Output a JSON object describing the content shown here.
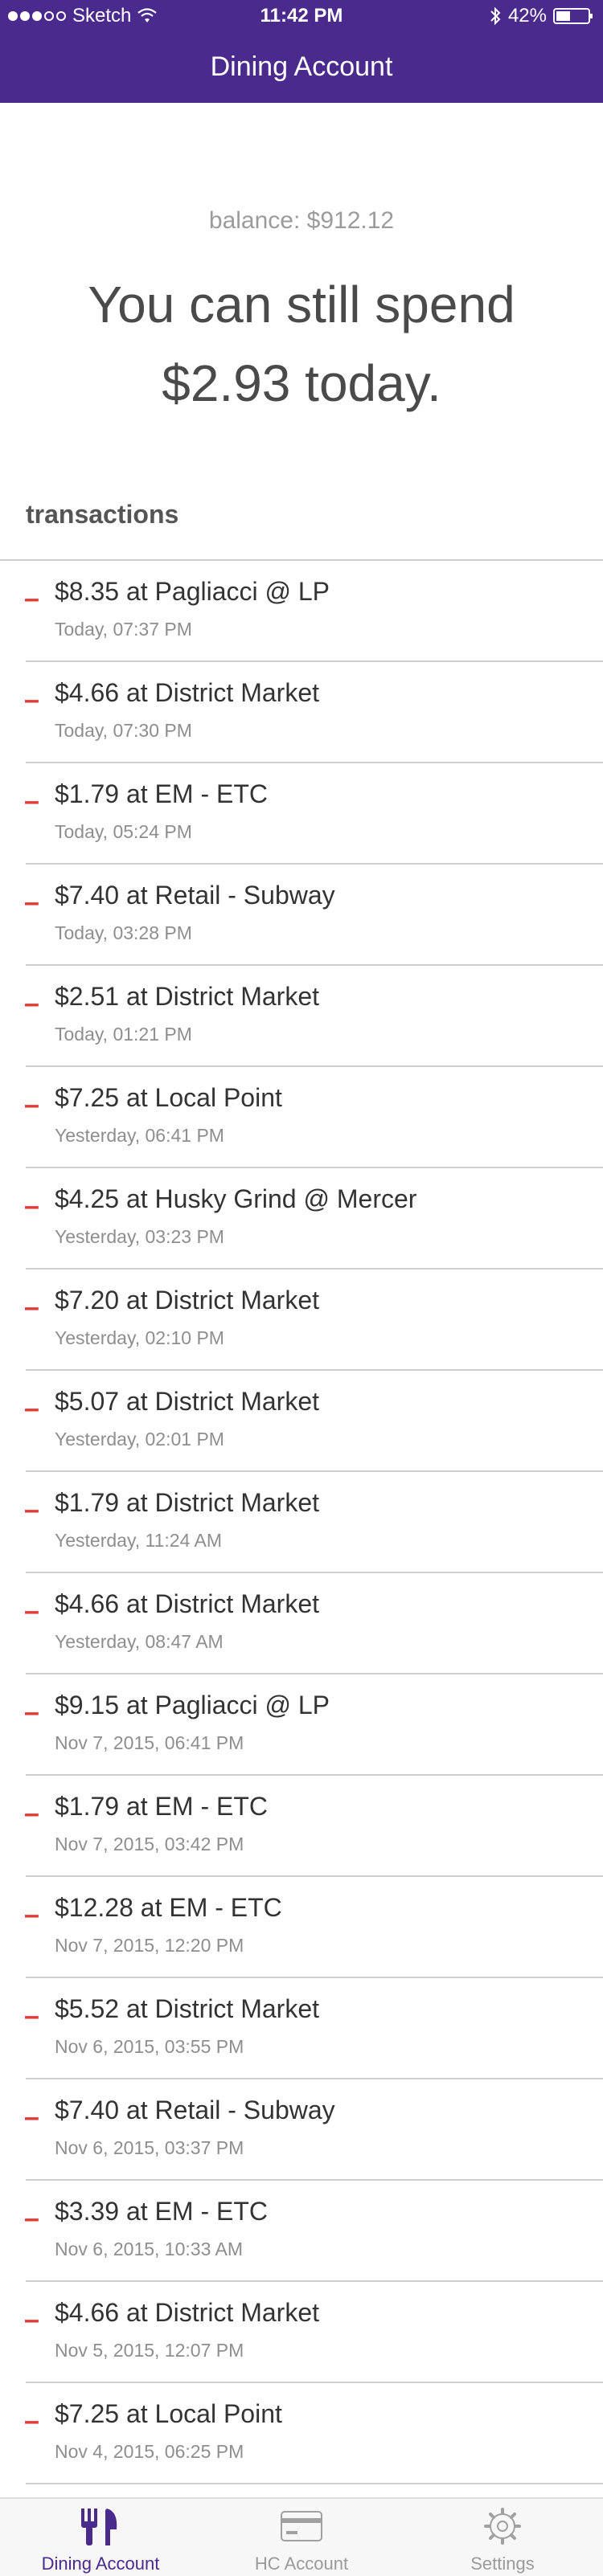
{
  "status_bar": {
    "carrier": "Sketch",
    "time": "11:42 PM",
    "battery": "42%"
  },
  "header": {
    "title": "Dining Account"
  },
  "summary": {
    "balance": "balance: $912.12",
    "spend_line1": "You can still spend",
    "spend_line2": "$2.93 today."
  },
  "transactions": {
    "title": "transactions",
    "items": [
      {
        "sign": "–",
        "label": "$8.35 at Pagliacci @ LP",
        "time": "Today, 07:37 PM"
      },
      {
        "sign": "–",
        "label": "$4.66 at District Market",
        "time": "Today, 07:30 PM"
      },
      {
        "sign": "–",
        "label": "$1.79 at EM - ETC",
        "time": "Today, 05:24 PM"
      },
      {
        "sign": "–",
        "label": "$7.40 at Retail - Subway",
        "time": "Today, 03:28 PM"
      },
      {
        "sign": "–",
        "label": "$2.51 at District Market",
        "time": "Today, 01:21 PM"
      },
      {
        "sign": "–",
        "label": "$7.25 at Local Point",
        "time": "Yesterday, 06:41 PM"
      },
      {
        "sign": "–",
        "label": "$4.25 at Husky Grind @ Mercer",
        "time": "Yesterday, 03:23 PM"
      },
      {
        "sign": "–",
        "label": "$7.20 at District Market",
        "time": "Yesterday, 02:10 PM"
      },
      {
        "sign": "–",
        "label": "$5.07 at District Market",
        "time": "Yesterday, 02:01 PM"
      },
      {
        "sign": "–",
        "label": "$1.79 at District Market",
        "time": "Yesterday, 11:24 AM"
      },
      {
        "sign": "–",
        "label": "$4.66 at District Market",
        "time": "Yesterday, 08:47 AM"
      },
      {
        "sign": "–",
        "label": "$9.15 at Pagliacci @ LP",
        "time": "Nov 7, 2015, 06:41 PM"
      },
      {
        "sign": "–",
        "label": "$1.79 at EM - ETC",
        "time": "Nov 7, 2015, 03:42 PM"
      },
      {
        "sign": "–",
        "label": "$12.28 at EM - ETC",
        "time": "Nov 7, 2015, 12:20 PM"
      },
      {
        "sign": "–",
        "label": "$5.52 at District Market",
        "time": "Nov 6, 2015, 03:55 PM"
      },
      {
        "sign": "–",
        "label": "$7.40 at Retail - Subway",
        "time": "Nov 6, 2015, 03:37 PM"
      },
      {
        "sign": "–",
        "label": "$3.39 at EM - ETC",
        "time": "Nov 6, 2015, 10:33 AM"
      },
      {
        "sign": "–",
        "label": "$4.66 at District Market",
        "time": "Nov 5, 2015, 12:07 PM"
      },
      {
        "sign": "–",
        "label": "$7.25 at Local Point",
        "time": "Nov 4, 2015, 06:25 PM"
      }
    ]
  },
  "tabbar": {
    "tabs": [
      {
        "label": "Dining Account",
        "icon": "fork-knife-icon",
        "active": true
      },
      {
        "label": "HC Account",
        "icon": "credit-card-icon",
        "active": false
      },
      {
        "label": "Settings",
        "icon": "gear-icon",
        "active": false
      }
    ]
  },
  "colors": {
    "brand": "#4b2a8e",
    "debit": "#e53935"
  }
}
